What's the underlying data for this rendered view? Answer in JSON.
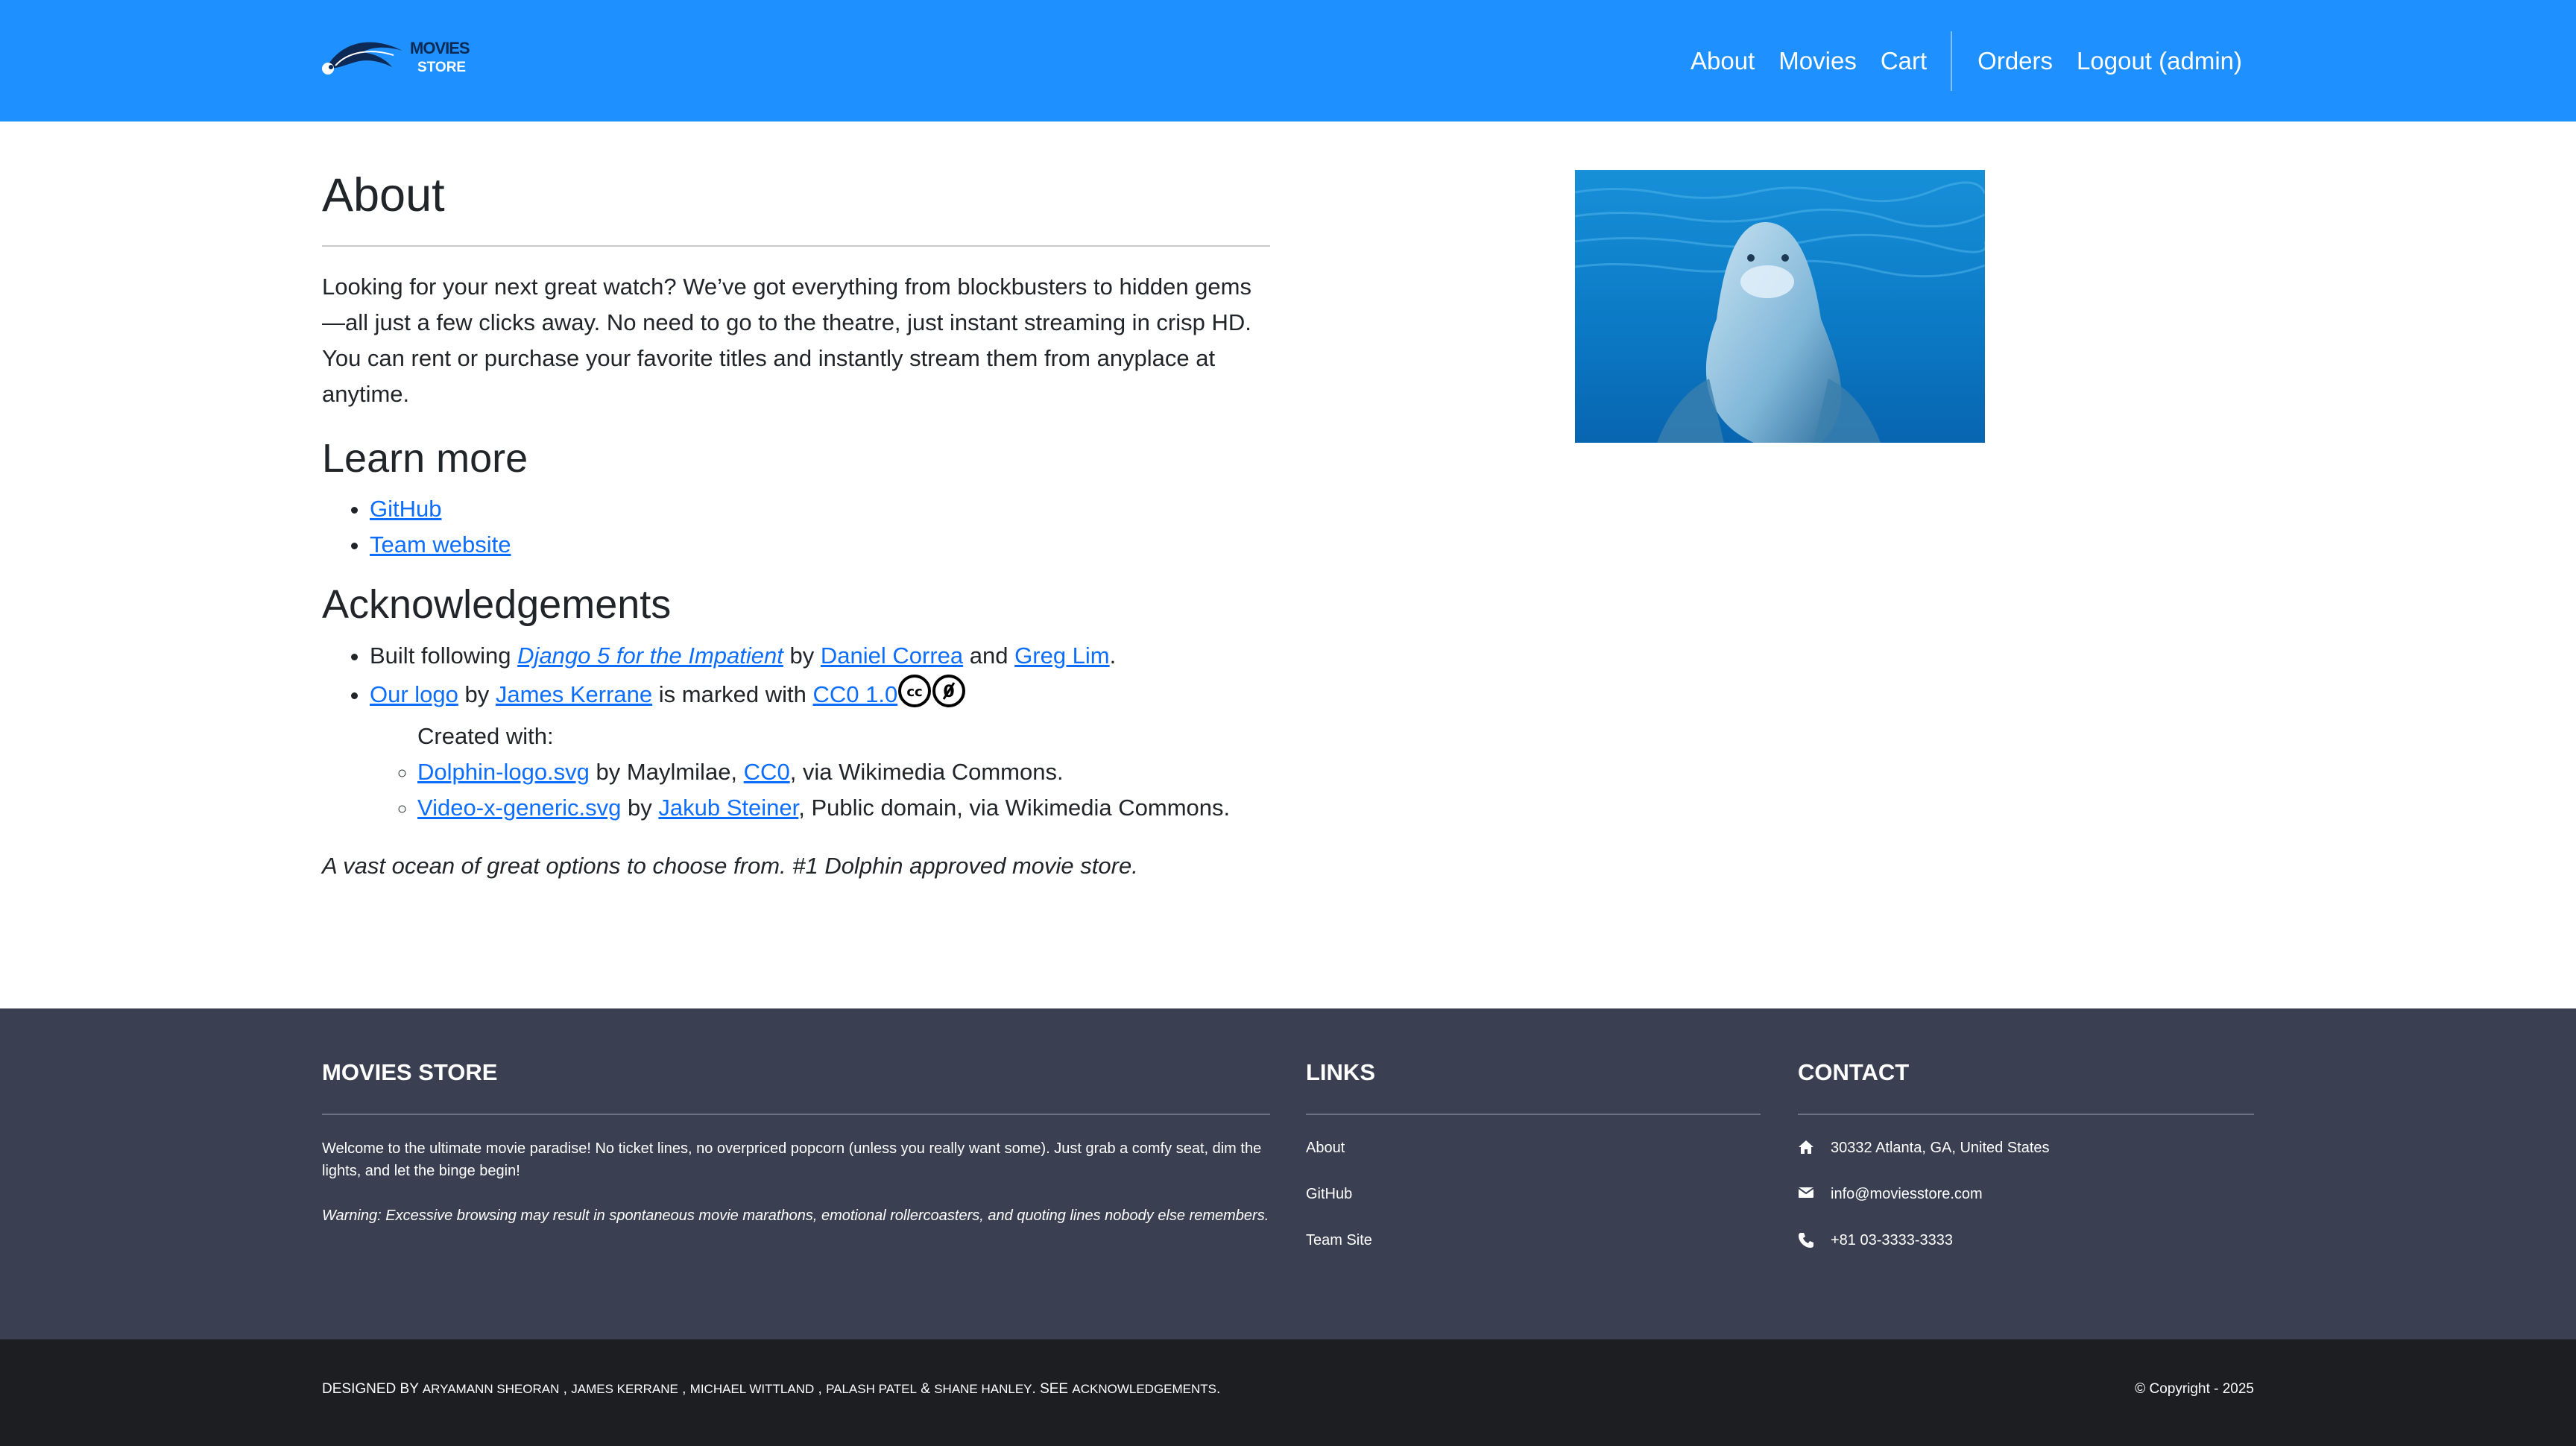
{
  "brand": {
    "logo_line1": "MOVIES",
    "logo_line2": "STORE",
    "colors": {
      "navbar": "#1e90ff",
      "footer": "#3a4052",
      "bottombar": "#1d1e21",
      "link": "#0d6efd"
    }
  },
  "nav": {
    "items": [
      "About",
      "Movies",
      "Cart"
    ],
    "user_items": [
      "Orders",
      "Logout (admin)"
    ]
  },
  "about": {
    "title": "About",
    "paragraph": "Looking for your next great watch? We’ve got everything from blockbusters to hidden gems—all just a few clicks away. No need to go to the theatre, just instant streaming in crisp HD. You can rent or purchase your favorite titles and instantly stream them from anyplace at anytime.",
    "image": "dolphin-photo"
  },
  "learn_more": {
    "title": "Learn more",
    "links": [
      "GitHub",
      "Team website"
    ]
  },
  "acknowledgements": {
    "title": "Acknowledgements",
    "built_prefix": "Built following",
    "book": "Django 5 for the Impatient",
    "by": "by",
    "author1": "Daniel Correa",
    "and": "and",
    "author2": "Greg Lim",
    "period": ".",
    "logo_link": "Our logo",
    "logo_by": "by",
    "logo_author": "James Kerrane",
    "marked_with": "is marked with",
    "license": "CC0 1.0",
    "created_with": "Created with:",
    "source1_link": "Dolphin-logo.svg",
    "source1_by": "by Maylmilae,",
    "source1_license": "CC0",
    "source1_suffix": ", via Wikimedia Commons.",
    "source2_link": "Video-x-generic.svg",
    "source2_by": "by",
    "source2_author": "Jakub Steiner",
    "source2_suffix": ", Public domain, via Wikimedia Commons.",
    "tagline": "A vast ocean of great options to choose from. #1 Dolphin approved movie store."
  },
  "footer": {
    "store_title": "MOVIES STORE",
    "store_text": "Welcome to the ultimate movie paradise! No ticket lines, no overpriced popcorn (unless you really want some). Just grab a comfy seat, dim the lights, and let the binge begin!",
    "store_warning": "Warning: Excessive browsing may result in spontaneous movie marathons, emotional rollercoasters, and quoting lines nobody else remembers.",
    "links_title": "LINKS",
    "links": [
      "About",
      "GitHub",
      "Team Site"
    ],
    "contact_title": "CONTACT",
    "address": "30332 Atlanta, GA, United States",
    "email": "info@moviesstore.com",
    "phone": "+81 03-3333-3333"
  },
  "bottom": {
    "designed_by": "DESIGNED BY",
    "names": [
      "ARYAMANN SHEORAN",
      "JAMES KERRANE",
      "MICHAEL WITTLAND",
      "PALASH PATEL",
      "SHANE HANLEY"
    ],
    "sep": ",",
    "amp": "&",
    "see": ". SEE",
    "ack": "ACKNOWLEDGEMENTS",
    "end": ".",
    "copyright": "© Copyright - 2025"
  }
}
